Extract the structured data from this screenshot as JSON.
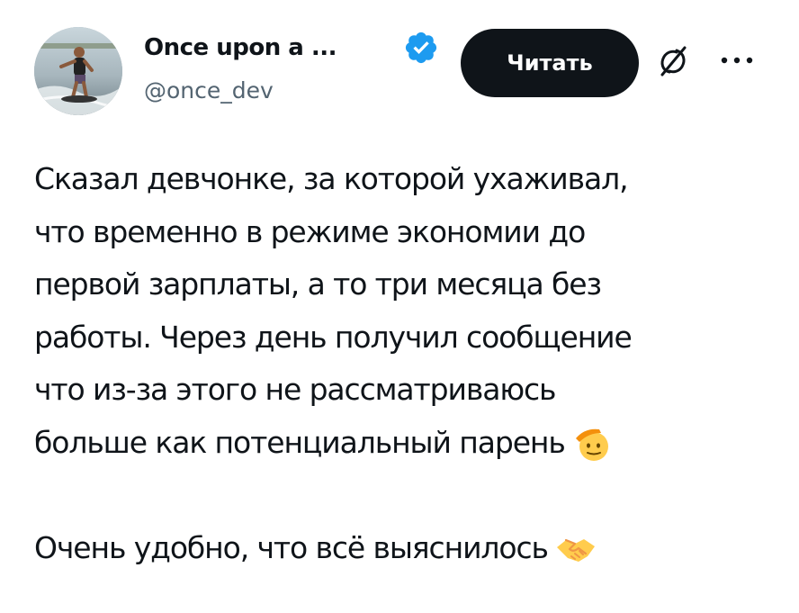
{
  "author": {
    "display_name": "Once upon a ...",
    "handle": "@once_dev",
    "verified": true,
    "avatar": "avatar-photo-wakesurfer"
  },
  "actions": {
    "read_label": "Читать",
    "grok_icon": "grok-icon",
    "more_icon": "more-icon"
  },
  "tweet": {
    "paragraph1_lines": [
      "Сказал девчонке, за которой ухаживал,",
      "что временно в режиме экономии до",
      "первой зарплаты, а то три месяца без",
      "работы. Через день получил сообщение",
      "что из-за этого не рассматриваюсь",
      "больше как потенциальный парень"
    ],
    "paragraph1_emoji": "saluting-face-emoji",
    "paragraph2": "Очень удобно, что всё выяснилось",
    "paragraph2_emoji": "handshake-emoji"
  },
  "colors": {
    "text": "#0f1419",
    "secondary_text": "#536471",
    "verified_badge": "#1d9bf0",
    "button_bg": "#0f1419",
    "button_text": "#ffffff"
  }
}
